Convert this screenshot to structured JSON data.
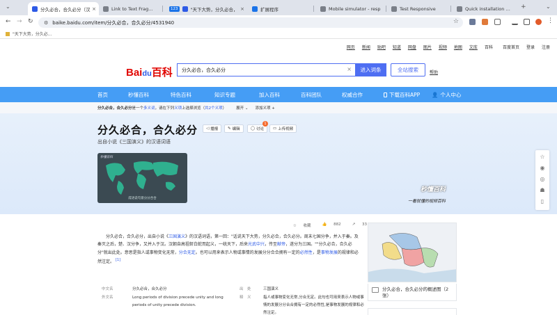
{
  "tabs": [
    {
      "label": "分久必合，合久必分（汉",
      "active": true,
      "fav_color": "#2d5ae6"
    },
    {
      "label": "Link to Text Fragment",
      "active": false,
      "fav_color": "#7a7f88"
    },
    {
      "label": "\"天下大势，分久必合，",
      "active": false,
      "fav_color": "#2d5ae6",
      "count_badge": "123"
    },
    {
      "label": "扩展程序",
      "active": false,
      "fav_color": "#1a73e8"
    },
    {
      "label": "Mobile simulator - resp",
      "active": false,
      "fav_color": "#7a7f88"
    },
    {
      "label": "Test Responsive",
      "active": false,
      "fav_color": "#7a7f88"
    },
    {
      "label": "Quick installation of th",
      "active": false,
      "fav_color": "#7a7f88"
    }
  ],
  "toolbar": {
    "url": "baike.baidu.com/item/分久必合，合久必分/4531940"
  },
  "bookmark": {
    "label": "\"天下大势，分久必..."
  },
  "topnav": [
    "网页",
    "新闻",
    "贴吧",
    "知道",
    "网盘",
    "图片",
    "视频",
    "地图",
    "文库",
    "百科",
    "百度首页",
    "登录",
    "注册"
  ],
  "search": {
    "query": "分久必合，合久必分",
    "enter_label": "进入词条",
    "site_label": "全站搜索",
    "help_label": "帮助"
  },
  "logo": {
    "text_left": "Bai",
    "text_mid": "du",
    "text_right": "百科"
  },
  "bluenav": [
    "首页",
    "秒懂百科",
    "特色百科",
    "知识专题",
    "加入百科",
    "百科团队",
    "权威合作",
    "下载百科APP",
    "个人中心"
  ],
  "subbar": {
    "term": "分久必合，合久必分",
    "prefix": "是一个",
    "polysemy": "多义词",
    "mid": "，请在下列",
    "meaning": "义项",
    "suffix": "上选择浏览（",
    "count": "共2个义项",
    "close": "）",
    "expand": "展开",
    "add": "添加义项"
  },
  "hero": {
    "title": "分久必合，合久必分",
    "subtitle": "出自小说《三国演义》的汉语词语",
    "buttons": [
      "播报",
      "编辑",
      "讨论",
      "上传视频"
    ],
    "discuss_count": "1",
    "image_logo": "秒懂百科",
    "image_caption": "成语说句意分分合合",
    "brand": "秒懂百科",
    "slogan": "一看就懂的视频百科"
  },
  "stats": {
    "collect": "收藏",
    "likes": "882",
    "shares": "33"
  },
  "article": {
    "p1": "分久必合，合久必分，出自小说《",
    "link1": "三国演义",
    "p2": "》的汉语词语，第一回：\"话说天下大势，分久必合，合久必分。周末七国分争，并入于秦。及秦灭之后，楚、汉分争，又并入于汉。汉朝自高祖斩白蛇而起义，一统天下，后来",
    "link2": "光武中兴",
    "p3": "，传至",
    "link3": "献帝",
    "p4": "，遂分为三国。\"\"分久必合，合久必分\"就出此处。意思是指人或事物变化无常，",
    "link4": "分合无定",
    "p5": "。也可以用来表示人物或事情的发展分分合合拥有一定的",
    "link5": "必然性",
    "p6": "，是",
    "link6": "事物发展",
    "p7": "的规律和必然注定。",
    "ref": "[1]"
  },
  "infobox": {
    "row1": {
      "key": "中文名",
      "val": "分久必合，合久必分",
      "key2": "出　处",
      "val2": "三国演义"
    },
    "row2": {
      "key": "外文名",
      "val": "Long periods of division precede unity and long periods of unity precede division.",
      "key2": "释　义",
      "val2": "指人或事物变化无常,分合无定。此句也可用来表示人物或事情的发展分分合合拥有一定的必然性,是事物发展的规律和必然注定。"
    }
  },
  "side": {
    "caption": "分久必合，合久必分的概述图（2张）"
  }
}
